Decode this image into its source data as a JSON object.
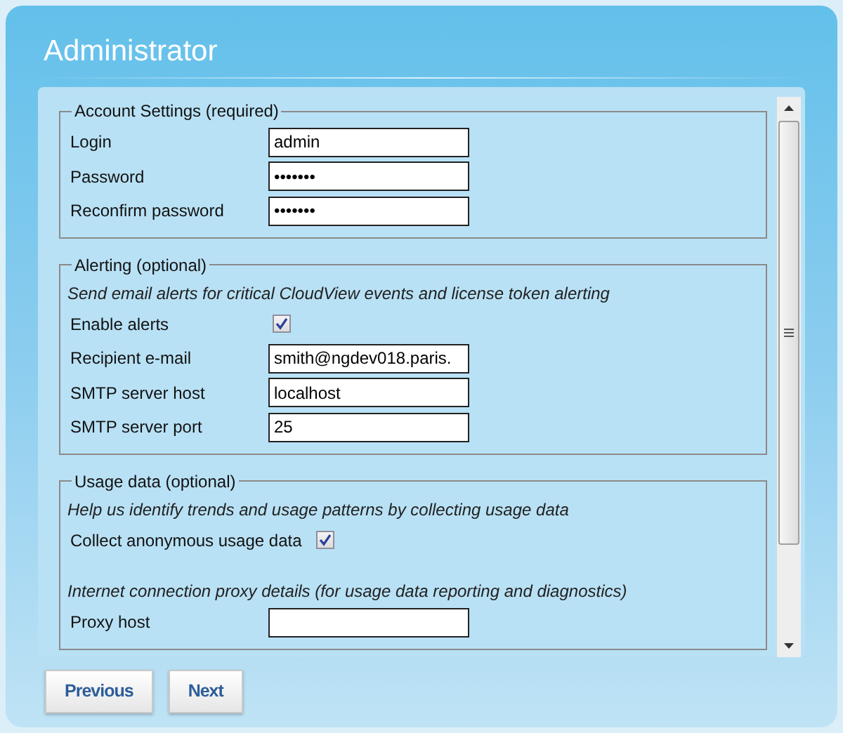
{
  "window": {
    "title": "Administrator"
  },
  "sections": [
    {
      "legend": "Account Settings (required)",
      "items": [
        {
          "kind": "field",
          "label": "Login",
          "value": "admin"
        },
        {
          "kind": "field",
          "label": "Password",
          "value": "•••••••"
        },
        {
          "kind": "field",
          "label": "Reconfirm password",
          "value": "•••••••"
        }
      ]
    },
    {
      "legend": "Alerting (optional)",
      "items": [
        {
          "kind": "note",
          "text": "Send email alerts for critical CloudView events and license token alerting"
        },
        {
          "kind": "checkbox",
          "label": "Enable alerts",
          "checked": true
        },
        {
          "kind": "field",
          "label": "Recipient e-mail",
          "value": "smith@ngdev018.paris."
        },
        {
          "kind": "field",
          "label": "SMTP server host",
          "value": "localhost"
        },
        {
          "kind": "field",
          "label": "SMTP server port",
          "value": "25"
        }
      ]
    },
    {
      "legend": "Usage data (optional)",
      "items": [
        {
          "kind": "note",
          "text": "Help us identify trends and usage patterns by collecting usage data"
        },
        {
          "kind": "checkbox",
          "label": "Collect anonymous usage data",
          "checked": true
        },
        {
          "kind": "note",
          "text": "Internet connection proxy details (for usage data reporting and diagnostics)"
        },
        {
          "kind": "field",
          "label": "Proxy host",
          "value": ""
        }
      ]
    }
  ],
  "buttons": [
    {
      "label": "Previous"
    },
    {
      "label": "Next"
    }
  ]
}
